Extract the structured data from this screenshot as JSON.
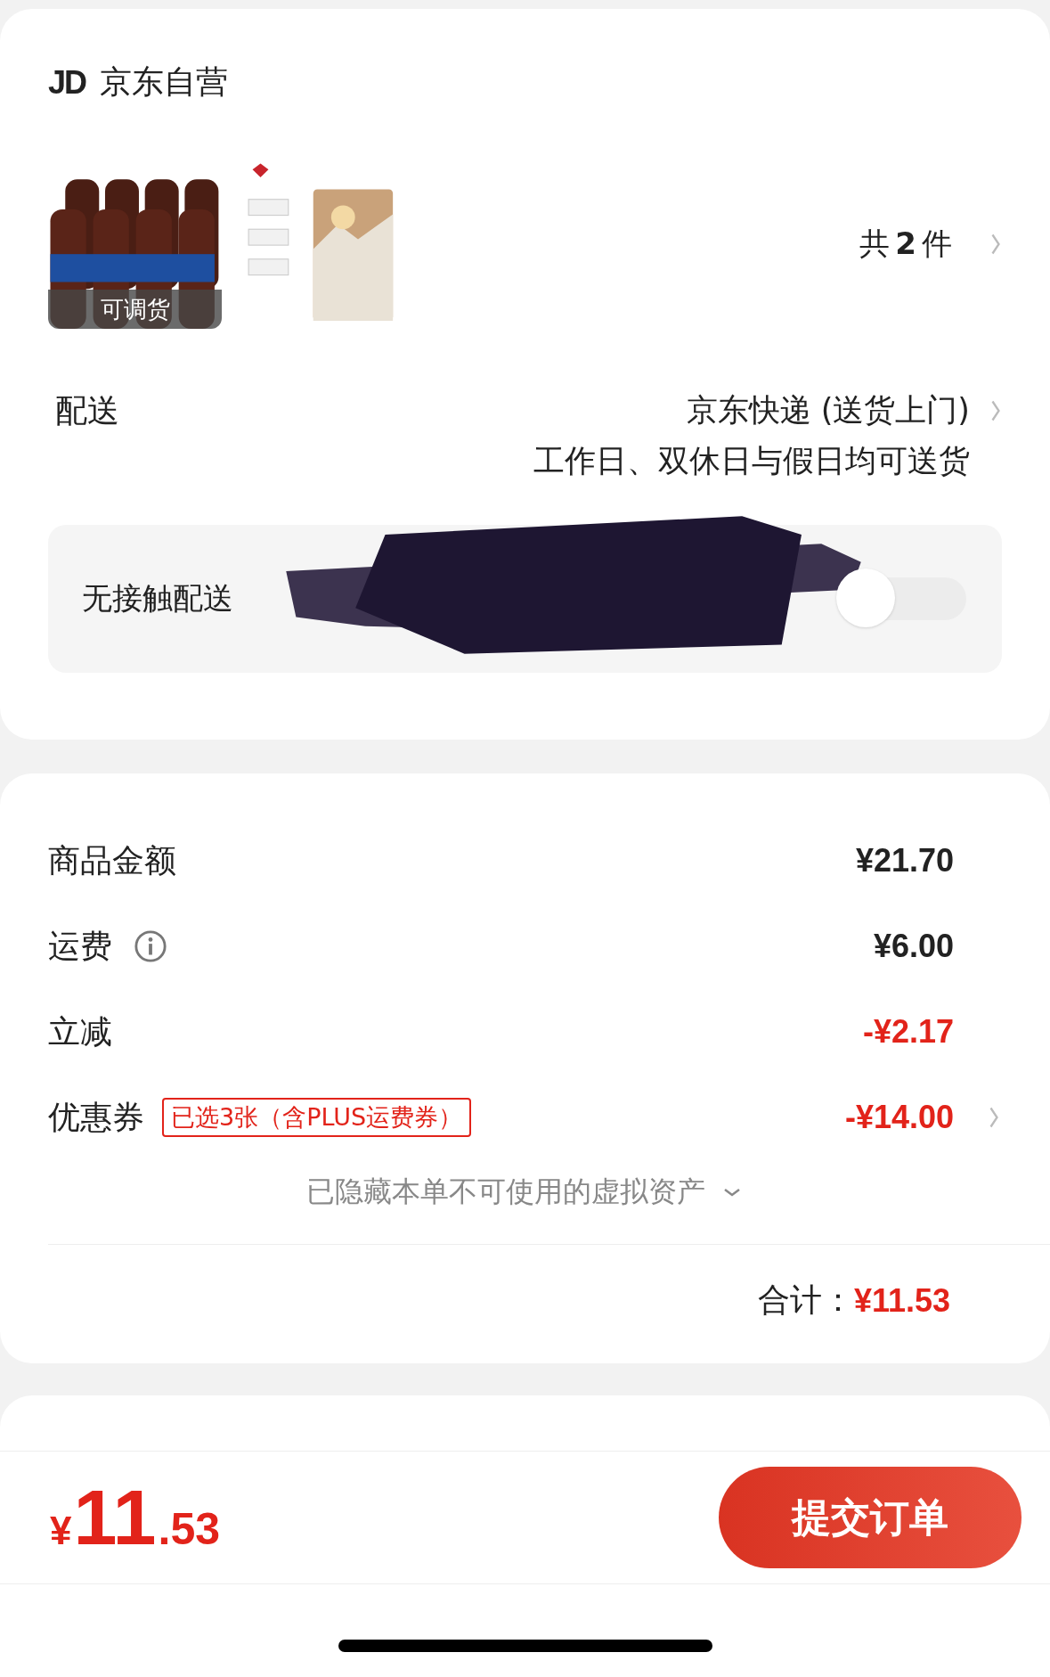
{
  "store": {
    "logo": "JD",
    "name": "京东自营"
  },
  "products": {
    "items": [
      {
        "kind": "picture",
        "badge": "可调货"
      },
      {
        "kind": "picture"
      }
    ],
    "count_prefix": "共",
    "count": "2",
    "count_suffix": "件"
  },
  "delivery": {
    "label": "配送",
    "method": "京东快递 (送货上门)",
    "schedule": "工作日、双休日与假日均可送货",
    "contactless": {
      "label": "无接触配送",
      "on": false
    }
  },
  "summary": {
    "rows": [
      {
        "label": "商品金额",
        "value": "¥21.70",
        "kind": "normal",
        "info": false,
        "arrow": false
      },
      {
        "label": "运费",
        "value": "¥6.00",
        "kind": "normal",
        "info": true,
        "arrow": false
      },
      {
        "label": "立减",
        "value": "-¥2.17",
        "kind": "discount",
        "info": false,
        "arrow": false
      },
      {
        "label": "优惠券",
        "tag": "已选3张（含PLUS运费券）",
        "value": "-¥14.00",
        "kind": "discount",
        "info": false,
        "arrow": true
      }
    ],
    "hidden_note": "已隐藏本单不可使用的虚拟资产",
    "total_label": "合计：",
    "total_value": "¥11.53"
  },
  "footer": {
    "currency": "¥",
    "amount_int": "11",
    "amount_dec": ".53",
    "submit": "提交订单"
  }
}
